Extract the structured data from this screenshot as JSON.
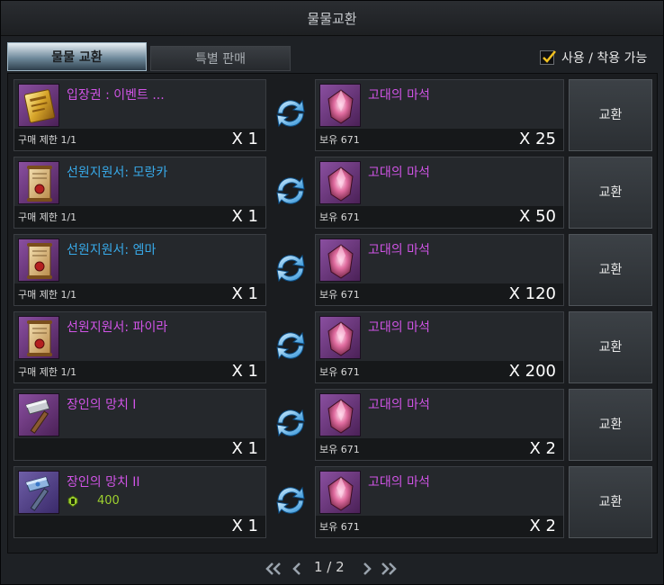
{
  "window": {
    "title": "물물교환"
  },
  "tabs": [
    {
      "label": "물물 교환"
    },
    {
      "label": "특별 판매"
    }
  ],
  "filter": {
    "label": "사용 / 착용 가능",
    "checked": true
  },
  "rows": [
    {
      "item_name": "입장권 : 이벤트 ...",
      "item_name_color": "#d054e6",
      "item_icon": "golden-ticket-icon",
      "limit": "구매 제한 1/1",
      "qty": "X 1",
      "cost_name": "고대의 마석",
      "cost_icon": "ancient-magic-stone-icon",
      "own": "보유 671",
      "cost_qty": "X 25",
      "button": "교환"
    },
    {
      "item_name": "선원지원서: 모랑카",
      "item_name_color": "#38a9e8",
      "item_icon": "sailor-application-scroll-icon",
      "limit": "구매 제한 1/1",
      "qty": "X 1",
      "cost_name": "고대의 마석",
      "cost_icon": "ancient-magic-stone-icon",
      "own": "보유 671",
      "cost_qty": "X 50",
      "button": "교환"
    },
    {
      "item_name": "선원지원서: 엠마",
      "item_name_color": "#38a9e8",
      "item_icon": "sailor-application-scroll-icon",
      "limit": "구매 제한 1/1",
      "qty": "X 1",
      "cost_name": "고대의 마석",
      "cost_icon": "ancient-magic-stone-icon",
      "own": "보유 671",
      "cost_qty": "X 120",
      "button": "교환"
    },
    {
      "item_name": "선원지원서: 파이라",
      "item_name_color": "#d054e6",
      "item_icon": "sailor-application-scroll-icon",
      "limit": "구매 제한 1/1",
      "qty": "X 1",
      "cost_name": "고대의 마석",
      "cost_icon": "ancient-magic-stone-icon",
      "own": "보유 671",
      "cost_qty": "X 200",
      "button": "교환"
    },
    {
      "item_name": "장인의 망치 I",
      "item_name_color": "#d054e6",
      "item_icon": "artisan-hammer-icon",
      "limit": "",
      "qty": "X 1",
      "cost_name": "고대의 마석",
      "cost_icon": "ancient-magic-stone-icon",
      "own": "보유 671",
      "cost_qty": "X 2",
      "button": "교환"
    },
    {
      "item_name": "장인의 망치 II",
      "item_name_color": "#d054e6",
      "item_icon": "artisan-hammer-icon",
      "requirement": "400",
      "requirement_icon": "item-level-icon",
      "limit": "",
      "qty": "X 1",
      "cost_name": "고대의 마석",
      "cost_icon": "ancient-magic-stone-icon",
      "own": "보유 671",
      "cost_qty": "X 2",
      "button": "교환"
    }
  ],
  "pager": {
    "text": "1 / 2"
  },
  "colors": {
    "legendary": "#d054e6",
    "epic": "#38a9e8",
    "requirement": "#9ed12f"
  }
}
